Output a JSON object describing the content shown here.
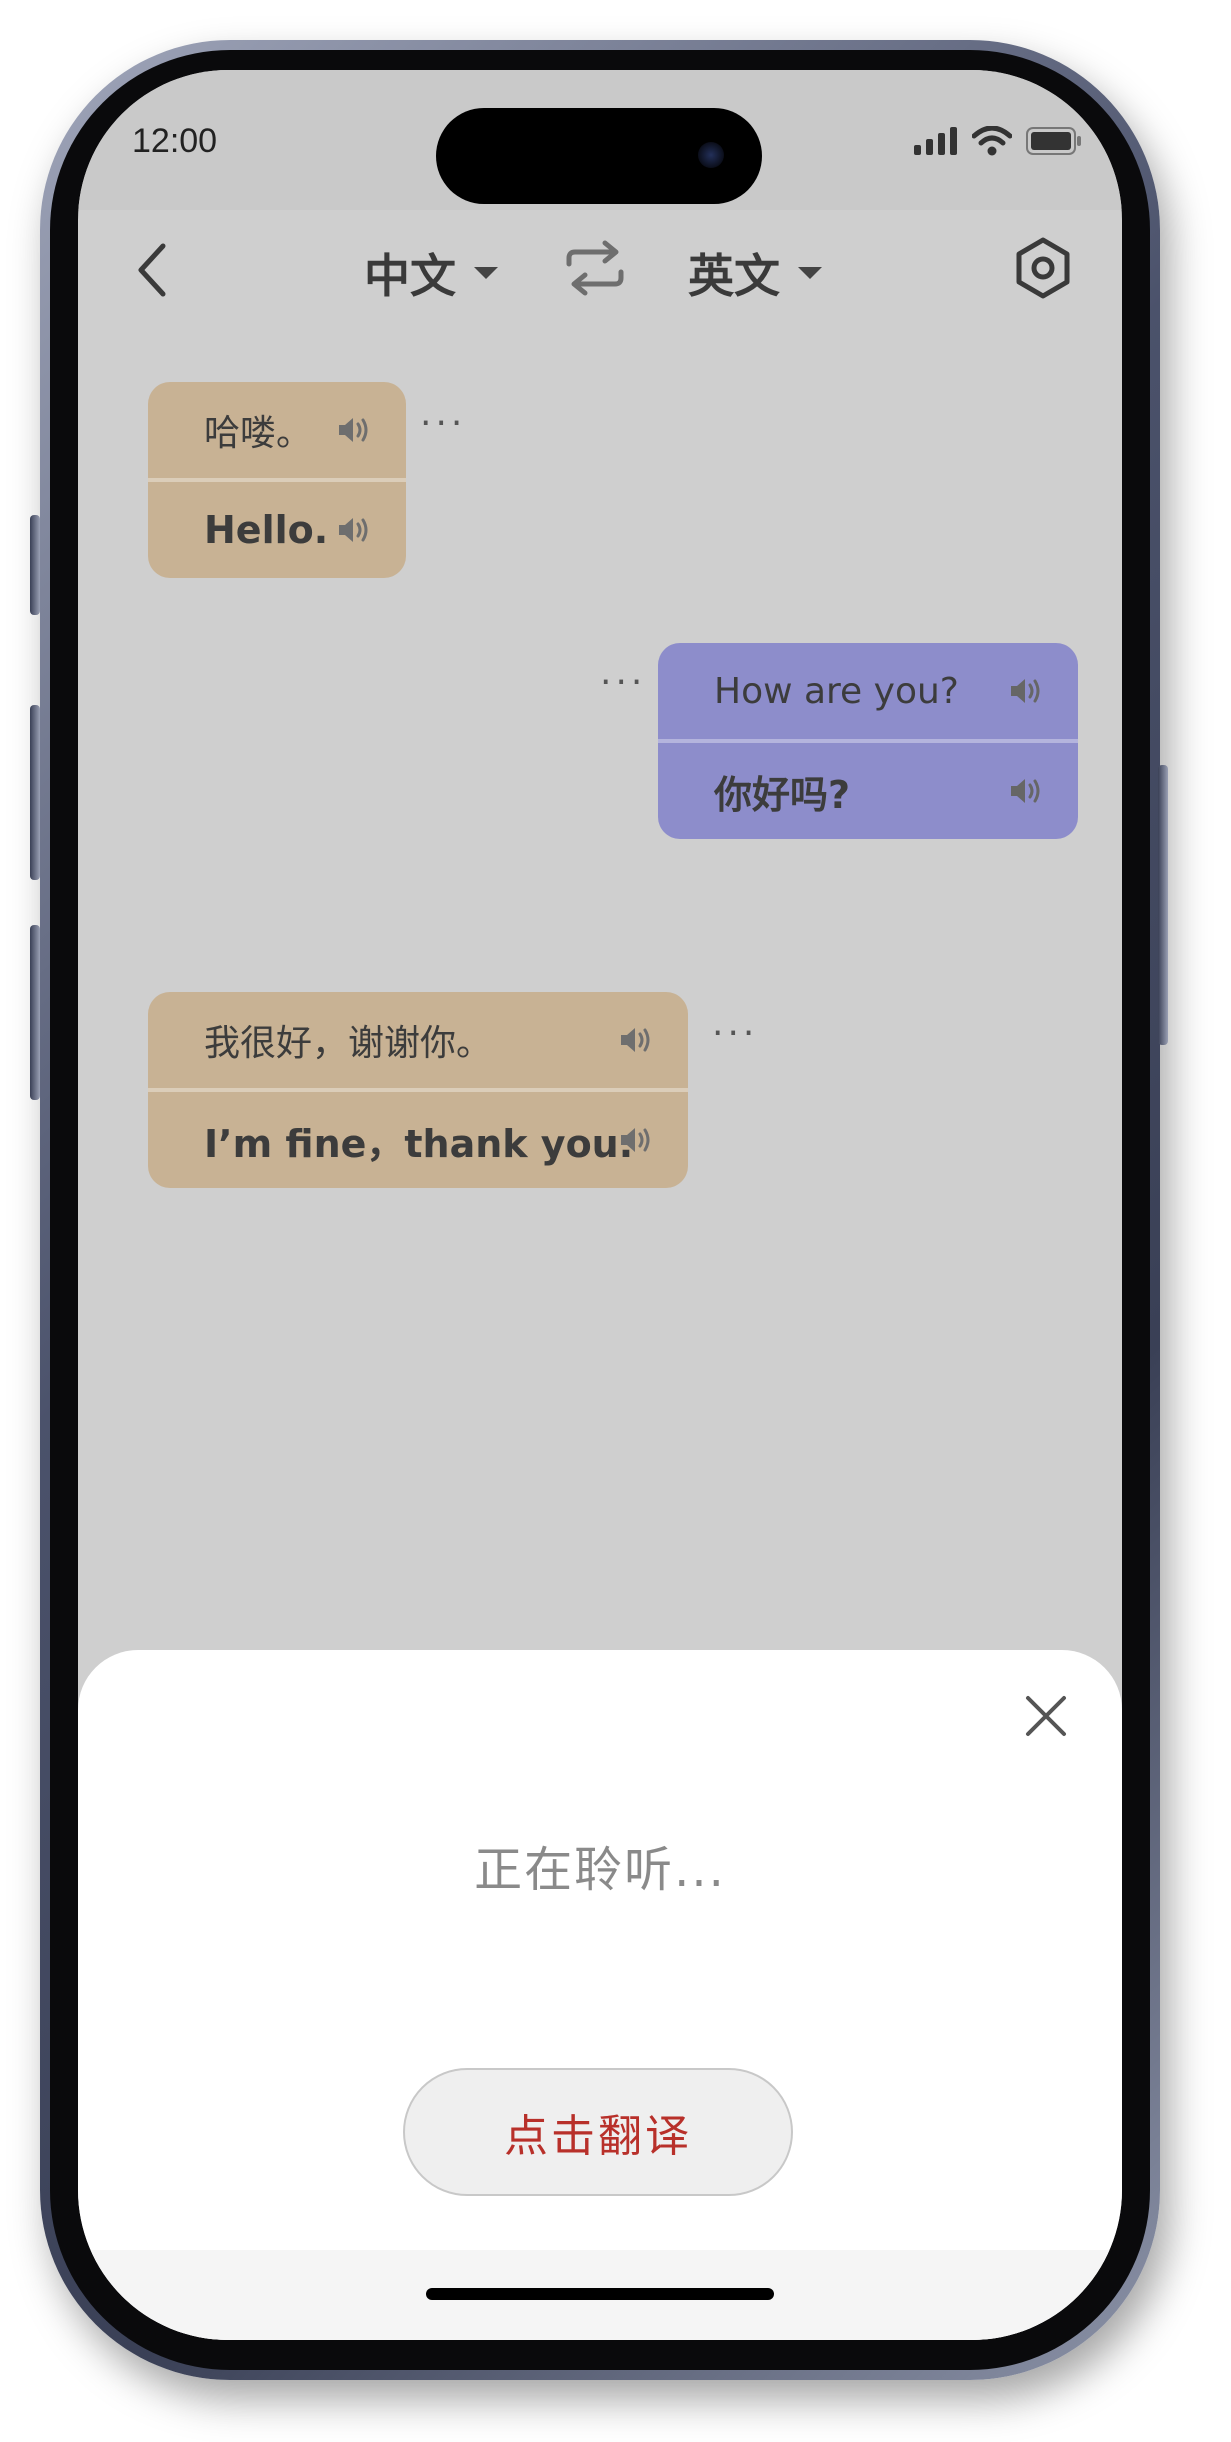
{
  "status": {
    "time": "12:00"
  },
  "nav": {
    "source_lang": "中文",
    "target_lang": "英文"
  },
  "messages": [
    {
      "side": "left",
      "original": "哈喽。",
      "translation": "Hello.",
      "more": "···"
    },
    {
      "side": "right",
      "original": "How are you?",
      "translation": "你好吗?",
      "more": "···"
    },
    {
      "side": "left",
      "original": "我很好，谢谢你。",
      "translation": "I’m fine，thank you.",
      "more": "···"
    }
  ],
  "sheet": {
    "status_text": "正在聆听...",
    "action_label": "点击翻译"
  },
  "colors": {
    "left_bubble": "#c8b294",
    "right_bubble": "#8d8dcb",
    "chat_bg": "#cfcfcf",
    "action_text": "#b8302a"
  },
  "icons": {
    "back": "chevron-left-icon",
    "swap": "swap-icon",
    "settings": "hexagon-settings-icon",
    "speaker": "speaker-icon",
    "close": "close-icon"
  }
}
